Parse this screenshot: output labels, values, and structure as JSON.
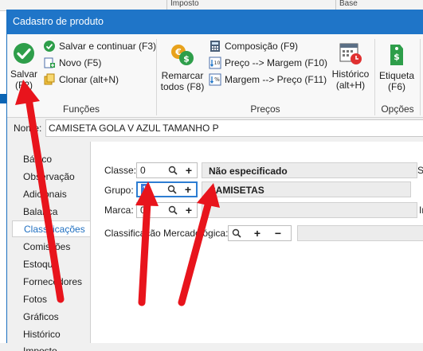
{
  "background": {
    "strip_labels": [
      "Imposto",
      "Base"
    ]
  },
  "window": {
    "title": "Cadastro de produto"
  },
  "ribbon": {
    "funcoes": {
      "label": "Funções",
      "save": "Salvar (F2)",
      "save_continue": "Salvar e continuar (F3)",
      "new": "Novo (F5)",
      "clone": "Clonar (alt+N)"
    },
    "precos": {
      "label": "Preços",
      "reprice": "Remarcar todos (F8)",
      "composition": "Composição (F9)",
      "price_margin": "Preço --> Margem (F10)",
      "margin_price": "Margem --> Preço (F11)",
      "history": "Histórico (alt+H)"
    },
    "opcoes": {
      "label": "Opções",
      "label_button": "Etiqueta (F6)"
    }
  },
  "name_field": {
    "label": "Nome:",
    "value": "CAMISETA GOLA V AZUL TAMANHO P"
  },
  "nav": {
    "items": [
      "Básico",
      "Observação",
      "Adicionais",
      "Balança",
      "Classificações",
      "Comissões",
      "Estoque",
      "Fornecedores",
      "Fotos",
      "Gráficos",
      "Histórico",
      "Imposto"
    ],
    "active": "Classificações"
  },
  "form": {
    "classe": {
      "label": "Classe:",
      "code": "0",
      "description": "Não especificado"
    },
    "grupo": {
      "label": "Grupo:",
      "code": "1",
      "description": "CAMISETAS"
    },
    "marca": {
      "label": "Marca:",
      "code": "0",
      "description": ""
    },
    "mercadologica": {
      "label": "Classificação Mercadológica:",
      "description": ""
    },
    "edge_s": "S",
    "edge_in": "In"
  },
  "colors": {
    "accent": "#1f75c8",
    "annotation_arrow": "#e8141c"
  }
}
